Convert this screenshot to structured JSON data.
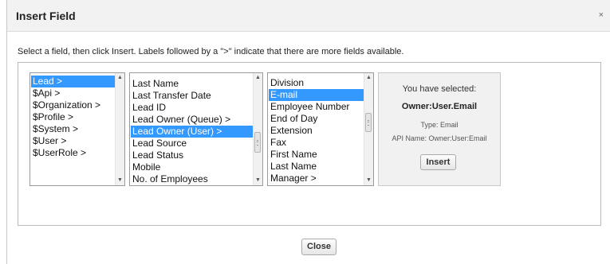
{
  "dialog": {
    "title": "Insert Field",
    "close_glyph": "×",
    "instructions": "Select a field, then click Insert. Labels followed by a \">\" indicate that there are more fields available."
  },
  "lists": {
    "objects": {
      "items": [
        "Lead >",
        "$Api >",
        "$Organization >",
        "$Profile >",
        "$System >",
        "$User >",
        "$UserRole >"
      ],
      "selected": "Lead >"
    },
    "lead_fields": {
      "items": [
        "Last Name",
        "Last Transfer Date",
        "Lead ID",
        "Lead Owner (Queue) >",
        "Lead Owner (User) >",
        "Lead Source",
        "Lead Status",
        "Mobile",
        "No. of Employees"
      ],
      "selected": "Lead Owner (User) >"
    },
    "user_fields": {
      "items": [
        "Division",
        "E-mail",
        "Employee Number",
        "End of Day",
        "Extension",
        "Fax",
        "First Name",
        "Last Name",
        "Manager >"
      ],
      "selected": "E-mail"
    }
  },
  "selection": {
    "caption": "You have selected:",
    "field": "Owner:User.Email",
    "type": "Type: Email",
    "api_name": "API Name: Owner:User:Email",
    "insert_label": "Insert"
  },
  "footer": {
    "close_label": "Close"
  },
  "icons": {
    "scroll_up": "arrow-up-icon",
    "scroll_down": "arrow-down-icon",
    "close": "close-icon"
  },
  "colors": {
    "selection_bg": "#3399ff",
    "title_bar": "#f2f2f2"
  }
}
